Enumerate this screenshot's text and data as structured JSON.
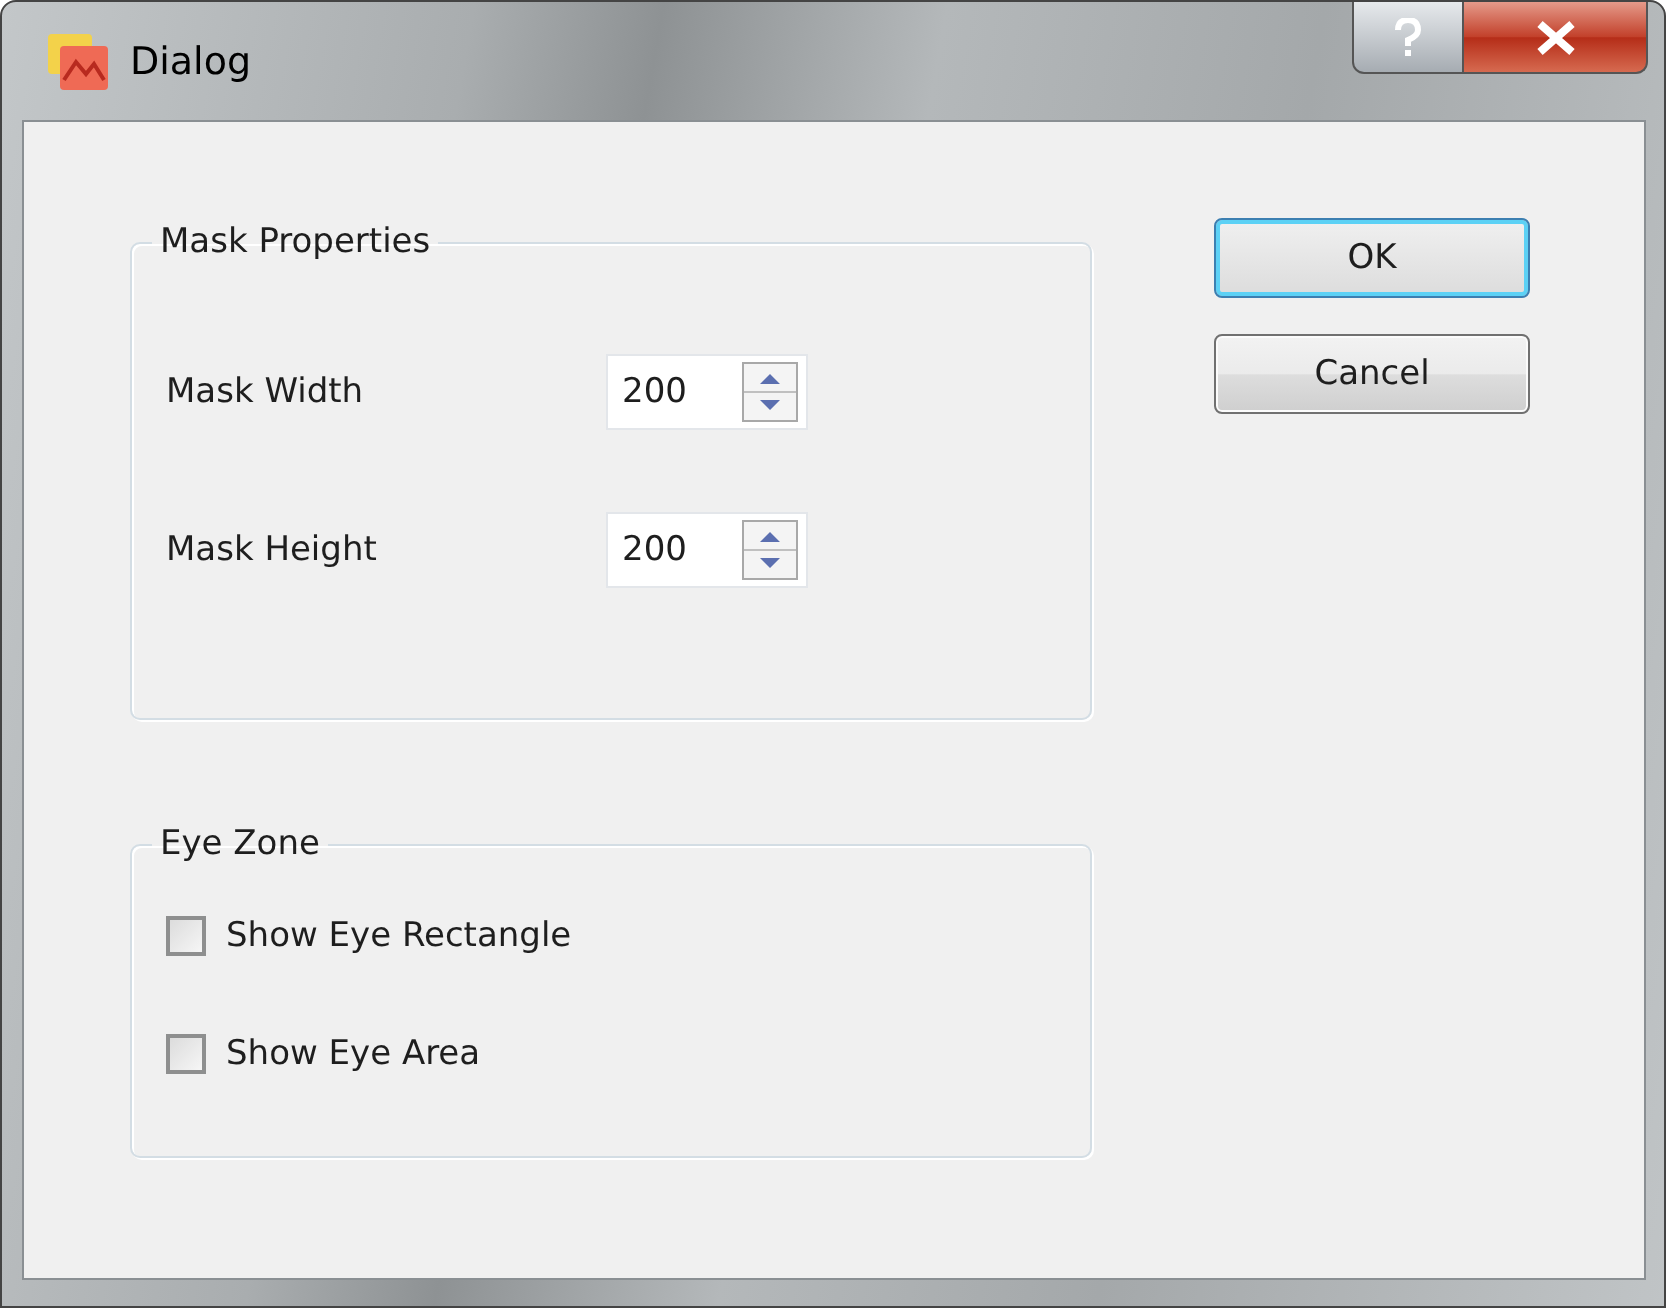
{
  "window": {
    "title": "Dialog"
  },
  "mask_properties": {
    "title": "Mask Properties",
    "fields": [
      {
        "label": "Mask Width",
        "value": "200"
      },
      {
        "label": "Mask Height",
        "value": "200"
      }
    ]
  },
  "eye_zone": {
    "title": "Eye Zone",
    "checkboxes": [
      {
        "label": "Show Eye Rectangle",
        "checked": false
      },
      {
        "label": "Show Eye Area",
        "checked": false
      }
    ]
  },
  "buttons": [
    {
      "label": "OK",
      "default": true
    },
    {
      "label": "Cancel",
      "default": false
    }
  ]
}
